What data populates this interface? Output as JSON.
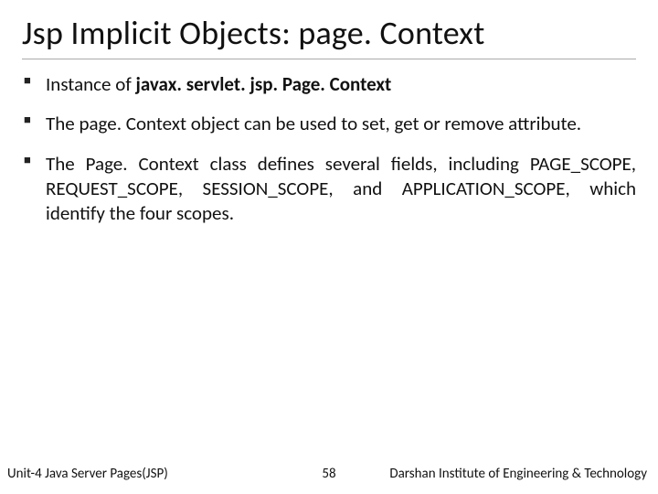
{
  "title": "Jsp Implicit Objects:  page. Context",
  "bullets": {
    "b1_prefix": "Instance of ",
    "b1_bold": "javax. servlet. jsp. Page. Context",
    "b2": "The page. Context object can be used to set, get or remove attribute.",
    "b3": "The Page. Context class defines several fields, including PAGE_SCOPE, REQUEST_SCOPE, SESSION_SCOPE, and APPLICATION_SCOPE, which identify the four scopes."
  },
  "footer": {
    "left": "Unit-4 Java Server Pages(JSP)",
    "page": "58",
    "right": "Darshan Institute of Engineering & Technology"
  }
}
